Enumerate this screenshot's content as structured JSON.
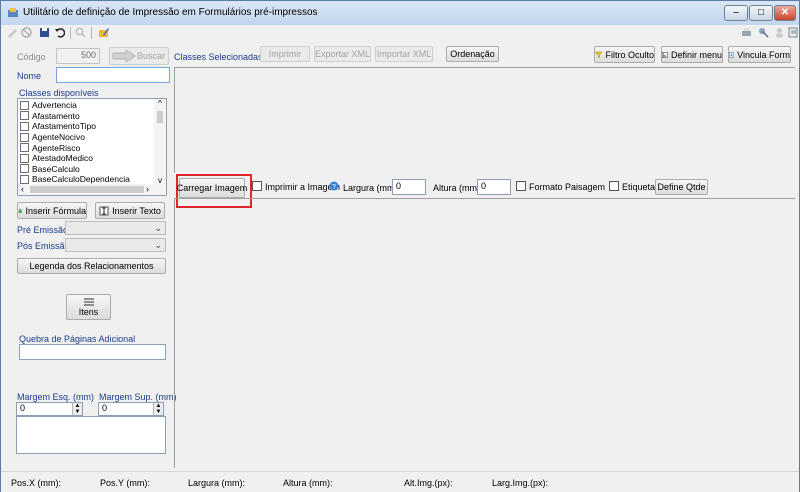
{
  "window": {
    "title": "Utilitário de definição de Impressão em Formulários pré-impressos",
    "minimize": "–",
    "maximize": "□",
    "close": "✕"
  },
  "form": {
    "codigo_label": "Código",
    "codigo_value": "500",
    "buscar_label": "Buscar",
    "nome_label": "Nome",
    "nome_value": "",
    "classes_disponiveis_label": "Classes disponíveis",
    "classes_disponiveis": [
      "Advertencia",
      "Afastamento",
      "AfastamentoTipo",
      "AgenteNocivo",
      "AgenteRisco",
      "AtestadoMedico",
      "BaseCalculo",
      "BaseCalculoDependencia"
    ],
    "inserir_formula": "Inserir Fórmula",
    "inserir_texto": "Inserir Texto",
    "pre_emissao_label": "Pré Emissão",
    "pos_emissao_label": "Pós Emissão",
    "legenda": "Legenda dos Relacionamentos",
    "itens": "Itens",
    "quebra_label": "Quebra de Páginas Adicional",
    "margem_esq_label": "Margem Esq. (mm)",
    "margem_esq_value": "0",
    "margem_sup_label": "Margem Sup. (mm)",
    "margem_sup_value": "0"
  },
  "topbar": {
    "classes_selecionadas": "Classes Selecionadas",
    "imprimir": "Imprimir",
    "exportar_xml": "Exportar XML",
    "importar_xml": "Importar XML",
    "ordenacao": "Ordenação",
    "filtro_oculto": "Filtro Oculto",
    "definir_menu": "Definir menu",
    "vincula_form": "Vincula Form"
  },
  "image_bar": {
    "carregar_imagem": "Carregar Imagem",
    "imprimir_imagem": "Imprimir a Imagem",
    "largura_label": "Largura (mm):",
    "largura_value": "0",
    "altura_label": "Altura (mm):",
    "altura_value": "0",
    "formato_paisagem": "Formato Paisagem",
    "etiqueta": "Etiqueta",
    "define_qtde": "Define Qtde"
  },
  "status": {
    "posx": "Pos.X (mm):",
    "posy": "Pos.Y (mm):",
    "largura": "Largura (mm):",
    "altura": "Altura (mm):",
    "alt_img": "Alt.Img.(px):",
    "larg_img": "Larg.Img.(px):"
  },
  "colors": {
    "highlight": "#e0262b",
    "label_blue": "#1a3a8c"
  }
}
